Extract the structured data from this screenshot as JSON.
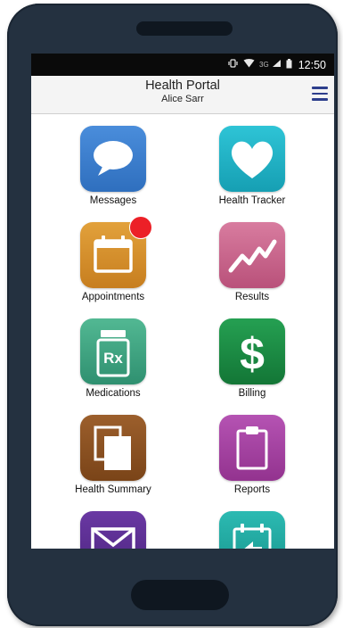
{
  "status_bar": {
    "network": "3G",
    "time": "12:50"
  },
  "header": {
    "title": "Health Portal",
    "user": "Alice Sarr"
  },
  "tiles": [
    {
      "label": "Messages",
      "color": "#3b7dcf",
      "icon": "speech-bubble-icon"
    },
    {
      "label": "Health Tracker",
      "color": "#21b5c8",
      "icon": "heart-icon"
    },
    {
      "label": "Appointments",
      "color": "#d9942c",
      "icon": "calendar-icon",
      "badge": true
    },
    {
      "label": "Results",
      "color": "#c9668c",
      "icon": "trend-chart-icon"
    },
    {
      "label": "Medications",
      "color": "#3fa784",
      "icon": "rx-bottle-icon"
    },
    {
      "label": "Billing",
      "color": "#1c8a45",
      "icon": "dollar-icon"
    },
    {
      "label": "Health Summary",
      "color": "#8e5222",
      "icon": "documents-icon"
    },
    {
      "label": "Reports",
      "color": "#a844a6",
      "icon": "clipboard-icon"
    },
    {
      "label": "",
      "color": "#5c2e91",
      "icon": "envelope-icon"
    },
    {
      "label": "",
      "color": "#22a8a0",
      "icon": "calendar-share-icon"
    }
  ]
}
